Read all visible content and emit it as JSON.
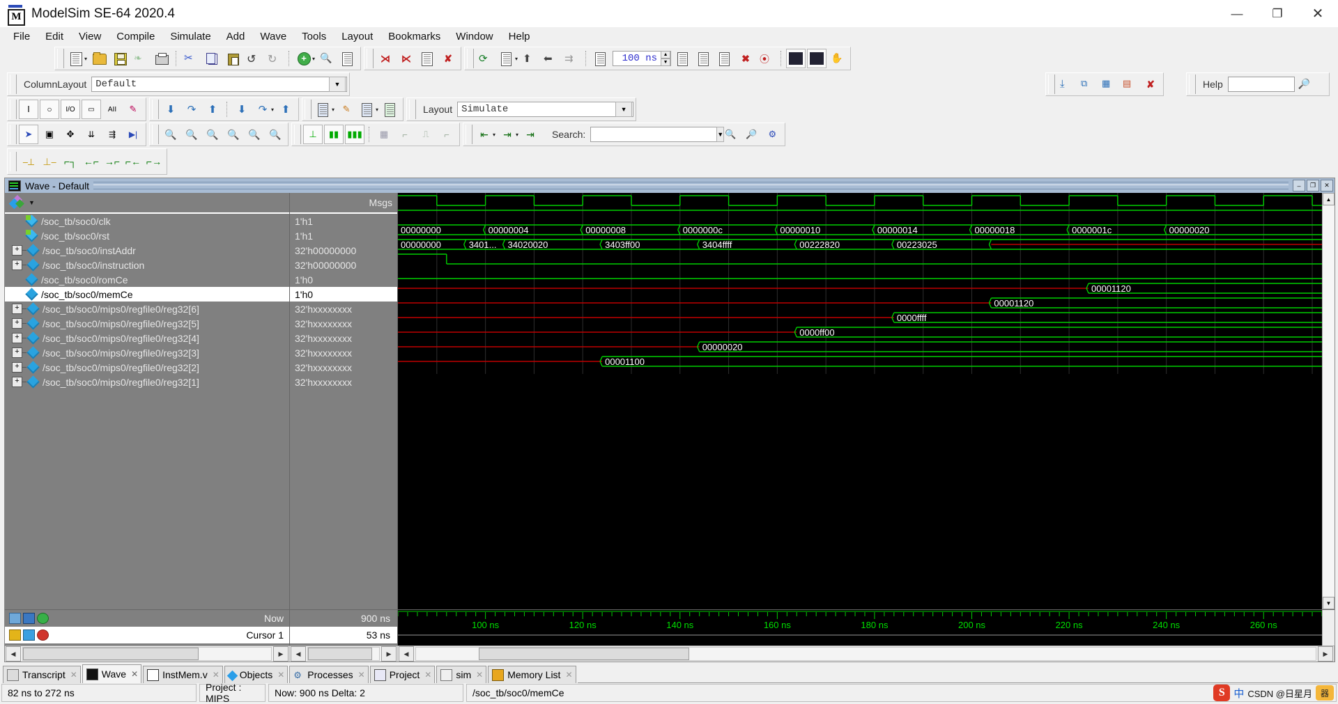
{
  "window": {
    "title": "ModelSim SE-64 2020.4",
    "logo_letter": "M",
    "minimize": "—",
    "maximize": "❐",
    "close": "✕"
  },
  "menu": [
    {
      "label": "File",
      "accel": "F"
    },
    {
      "label": "Edit",
      "accel": "E"
    },
    {
      "label": "View",
      "accel": "V"
    },
    {
      "label": "Compile",
      "accel": "C"
    },
    {
      "label": "Simulate",
      "accel": "S"
    },
    {
      "label": "Add",
      "accel": "d"
    },
    {
      "label": "Wave",
      "accel": "a"
    },
    {
      "label": "Tools",
      "accel": "T"
    },
    {
      "label": "Layout",
      "accel": "L"
    },
    {
      "label": "Bookmarks",
      "accel": "B"
    },
    {
      "label": "Window",
      "accel": "W"
    },
    {
      "label": "Help",
      "accel": "H"
    }
  ],
  "toolbar": {
    "run_time_value": "100 ns",
    "run_time_unit": "ns"
  },
  "column_layout": {
    "label": "ColumnLayout",
    "value": "Default"
  },
  "help": {
    "label": "Help",
    "value": ""
  },
  "layout": {
    "label": "Layout",
    "value": "Simulate"
  },
  "search": {
    "label": "Search:",
    "value": "",
    "placeholder": ""
  },
  "wave": {
    "title": "Wave - Default",
    "minimize": "–",
    "restore": "❐",
    "close": "✕",
    "msgs_header": "Msgs",
    "signals": [
      {
        "name": "/soc_tb/soc0/clk",
        "value": "1'h1",
        "expandable": false,
        "input": true,
        "selected": false
      },
      {
        "name": "/soc_tb/soc0/rst",
        "value": "1'h1",
        "expandable": false,
        "input": true,
        "selected": false
      },
      {
        "name": "/soc_tb/soc0/instAddr",
        "value": "32'h00000000",
        "expandable": true,
        "input": false,
        "selected": false
      },
      {
        "name": "/soc_tb/soc0/instruction",
        "value": "32'h00000000",
        "expandable": true,
        "input": false,
        "selected": false
      },
      {
        "name": "/soc_tb/soc0/romCe",
        "value": "1'h0",
        "expandable": false,
        "input": false,
        "selected": false
      },
      {
        "name": "/soc_tb/soc0/memCe",
        "value": "1'h0",
        "expandable": false,
        "input": false,
        "selected": true
      },
      {
        "name": "/soc_tb/soc0/mips0/regfile0/reg32[6]",
        "value": "32'hxxxxxxxx",
        "expandable": true,
        "input": false,
        "selected": false
      },
      {
        "name": "/soc_tb/soc0/mips0/regfile0/reg32[5]",
        "value": "32'hxxxxxxxx",
        "expandable": true,
        "input": false,
        "selected": false
      },
      {
        "name": "/soc_tb/soc0/mips0/regfile0/reg32[4]",
        "value": "32'hxxxxxxxx",
        "expandable": true,
        "input": false,
        "selected": false
      },
      {
        "name": "/soc_tb/soc0/mips0/regfile0/reg32[3]",
        "value": "32'hxxxxxxxx",
        "expandable": true,
        "input": false,
        "selected": false
      },
      {
        "name": "/soc_tb/soc0/mips0/regfile0/reg32[2]",
        "value": "32'hxxxxxxxx",
        "expandable": true,
        "input": false,
        "selected": false
      },
      {
        "name": "/soc_tb/soc0/mips0/regfile0/reg32[1]",
        "value": "32'hxxxxxxxx",
        "expandable": true,
        "input": false,
        "selected": false
      }
    ],
    "cursor_panel": {
      "now_label": "Now",
      "now_value": "900 ns",
      "cursor_label": "Cursor 1",
      "cursor_value": "53 ns"
    }
  },
  "chart_data": {
    "type": "waveform",
    "title": "Wave - Default",
    "time_axis": {
      "unit": "ns",
      "visible_start": 82,
      "visible_end": 272,
      "ticks": [
        100,
        120,
        140,
        160,
        180,
        200,
        220,
        240,
        260
      ],
      "tick_labels": [
        "100 ns",
        "120 ns",
        "140 ns",
        "160 ns",
        "180 ns",
        "200 ns",
        "220 ns",
        "240 ns",
        "260 ns"
      ],
      "minor_tick_step": 2
    },
    "clock_period_ns": 20,
    "rows": [
      {
        "signal": "/soc_tb/soc0/clk",
        "kind": "clock",
        "color": "#00d000",
        "period_ns": 20,
        "duty": 0.5,
        "phase_ns": 0
      },
      {
        "signal": "/soc_tb/soc0/rst",
        "kind": "level",
        "color": "#00d000",
        "level": "1",
        "segments": [
          {
            "start": 82,
            "end": 272,
            "value": "1"
          }
        ]
      },
      {
        "signal": "/soc_tb/soc0/instAddr",
        "kind": "bus",
        "color": "#00d000",
        "segments": [
          {
            "start": 82,
            "end": 100,
            "value": "00000000"
          },
          {
            "start": 100,
            "end": 120,
            "value": "00000004"
          },
          {
            "start": 120,
            "end": 140,
            "value": "00000008"
          },
          {
            "start": 140,
            "end": 160,
            "value": "0000000c"
          },
          {
            "start": 160,
            "end": 180,
            "value": "00000010"
          },
          {
            "start": 180,
            "end": 200,
            "value": "00000014"
          },
          {
            "start": 200,
            "end": 220,
            "value": "00000018"
          },
          {
            "start": 220,
            "end": 240,
            "value": "0000001c"
          },
          {
            "start": 240,
            "end": 272,
            "value": "00000020"
          }
        ]
      },
      {
        "signal": "/soc_tb/soc0/instruction",
        "kind": "bus",
        "color": "#00d000",
        "segments": [
          {
            "start": 82,
            "end": 96,
            "value": "00000000"
          },
          {
            "start": 96,
            "end": 104,
            "value": "3401..."
          },
          {
            "start": 104,
            "end": 124,
            "value": "34020020"
          },
          {
            "start": 124,
            "end": 144,
            "value": "3403ff00"
          },
          {
            "start": 144,
            "end": 164,
            "value": "3404ffff"
          },
          {
            "start": 164,
            "end": 184,
            "value": "00222820"
          },
          {
            "start": 184,
            "end": 204,
            "value": "00223025"
          },
          {
            "start": 204,
            "end": 272,
            "value": ""
          }
        ],
        "tail_color": "#c00000"
      },
      {
        "signal": "/soc_tb/soc0/romCe",
        "kind": "level",
        "color": "#00d000",
        "level": "0",
        "segments": [
          {
            "start": 82,
            "end": 92,
            "value": "1"
          },
          {
            "start": 92,
            "end": 272,
            "value": "0"
          }
        ]
      },
      {
        "signal": "/soc_tb/soc0/memCe",
        "kind": "level",
        "color": "#00d000",
        "level": "0",
        "segments": [
          {
            "start": 82,
            "end": 272,
            "value": "0"
          }
        ]
      },
      {
        "signal": "/soc_tb/soc0/mips0/regfile0/reg32[6]",
        "kind": "bus",
        "color": "#00d000",
        "undefined_color": "#c00000",
        "segments": [
          {
            "start": 82,
            "end": 224,
            "value": "xxxxxxxx",
            "undefined": true
          },
          {
            "start": 224,
            "end": 272,
            "value": "00001120"
          }
        ]
      },
      {
        "signal": "/soc_tb/soc0/mips0/regfile0/reg32[5]",
        "kind": "bus",
        "color": "#00d000",
        "undefined_color": "#c00000",
        "segments": [
          {
            "start": 82,
            "end": 204,
            "value": "xxxxxxxx",
            "undefined": true
          },
          {
            "start": 204,
            "end": 272,
            "value": "00001120"
          }
        ]
      },
      {
        "signal": "/soc_tb/soc0/mips0/regfile0/reg32[4]",
        "kind": "bus",
        "color": "#00d000",
        "undefined_color": "#c00000",
        "segments": [
          {
            "start": 82,
            "end": 184,
            "value": "xxxxxxxx",
            "undefined": true
          },
          {
            "start": 184,
            "end": 272,
            "value": "0000ffff"
          }
        ]
      },
      {
        "signal": "/soc_tb/soc0/mips0/regfile0/reg32[3]",
        "kind": "bus",
        "color": "#00d000",
        "undefined_color": "#c00000",
        "segments": [
          {
            "start": 82,
            "end": 164,
            "value": "xxxxxxxx",
            "undefined": true
          },
          {
            "start": 164,
            "end": 272,
            "value": "0000ff00"
          }
        ]
      },
      {
        "signal": "/soc_tb/soc0/mips0/regfile0/reg32[2]",
        "kind": "bus",
        "color": "#00d000",
        "undefined_color": "#c00000",
        "segments": [
          {
            "start": 82,
            "end": 144,
            "value": "xxxxxxxx",
            "undefined": true
          },
          {
            "start": 144,
            "end": 272,
            "value": "00000020"
          }
        ]
      },
      {
        "signal": "/soc_tb/soc0/mips0/regfile0/reg32[1]",
        "kind": "bus",
        "color": "#00d000",
        "undefined_color": "#c00000",
        "segments": [
          {
            "start": 82,
            "end": 124,
            "value": "xxxxxxxx",
            "undefined": true
          },
          {
            "start": 124,
            "end": 272,
            "value": "00001100"
          }
        ]
      }
    ],
    "cursor": {
      "name": "Cursor 1",
      "time_ns": 53
    },
    "now_ns": 900
  },
  "tabs": [
    {
      "label": "Transcript",
      "icon": "transcript-icon",
      "active": false
    },
    {
      "label": "Wave",
      "icon": "wave-icon",
      "active": true
    },
    {
      "label": "InstMem.v",
      "icon": "modelsim-file-icon",
      "active": false
    },
    {
      "label": "Objects",
      "icon": "objects-icon",
      "active": false
    },
    {
      "label": "Processes",
      "icon": "gear-icon",
      "active": false
    },
    {
      "label": "Project",
      "icon": "project-icon",
      "active": false
    },
    {
      "label": "sim",
      "icon": "sim-icon",
      "active": false
    },
    {
      "label": "Memory List",
      "icon": "memory-icon",
      "active": false
    }
  ],
  "statusbar": {
    "range": "82 ns to 272 ns",
    "project": "Project : MIPS",
    "now": "Now: 900 ns  Delta: 2",
    "path": "/soc_tb/soc0/memCe",
    "watermark_s": "S",
    "watermark_cn": "中",
    "watermark_text": "CSDN @日星月",
    "watermark_badge": "器"
  }
}
